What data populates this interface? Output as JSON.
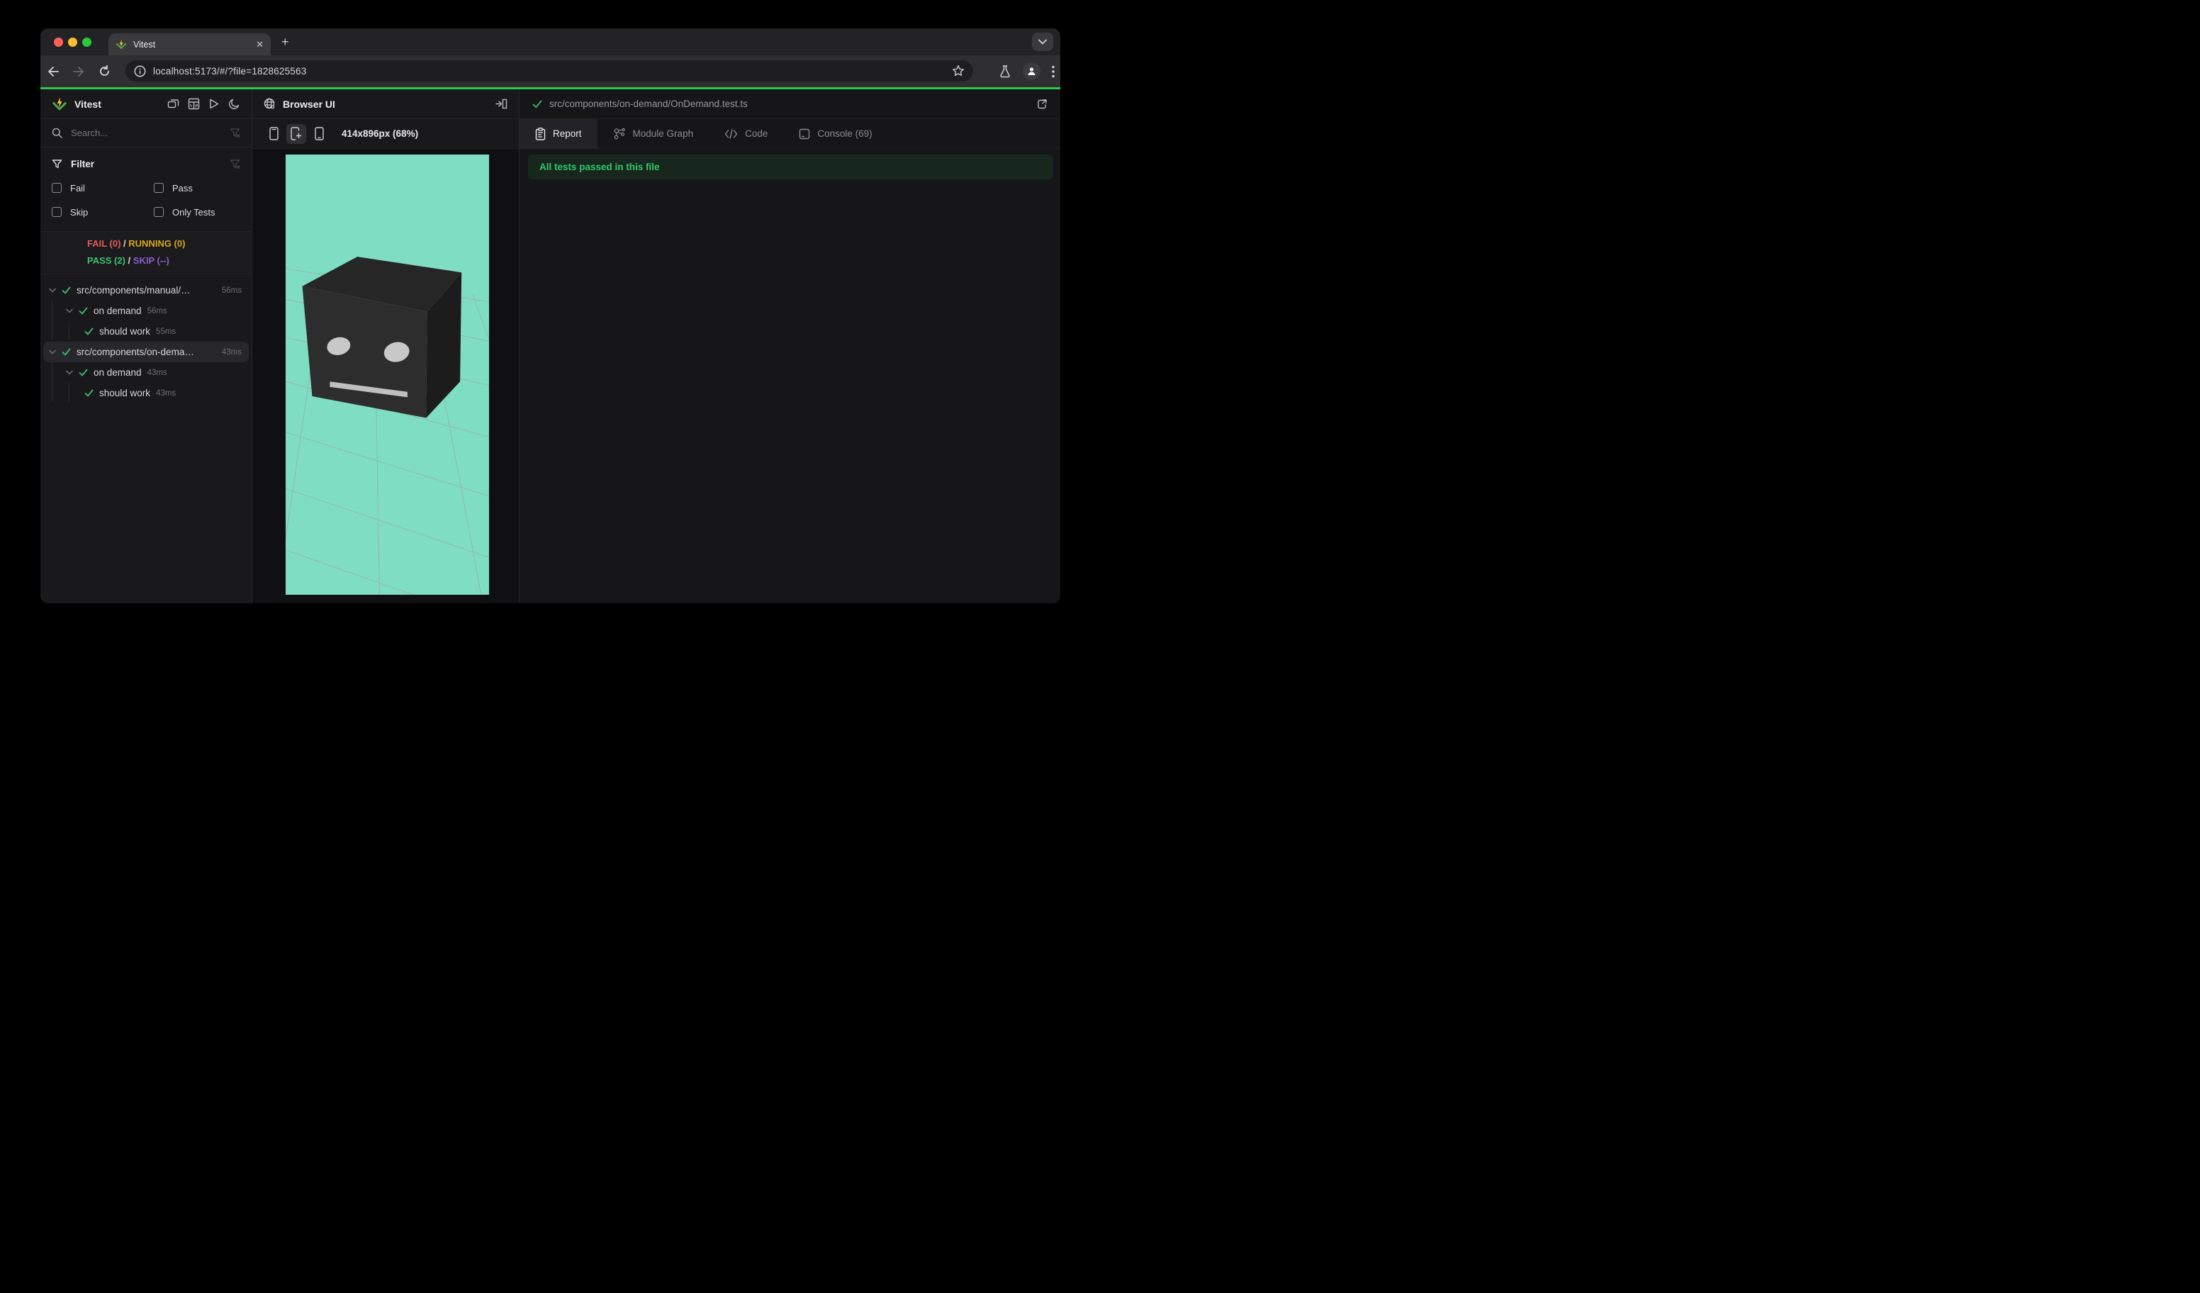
{
  "browser": {
    "tab_title": "Vitest",
    "close_label": "✕",
    "new_tab_label": "+",
    "url": "localhost:5173/#/?file=1828625563"
  },
  "sidebar": {
    "title": "Vitest",
    "search": {
      "placeholder": "Search..."
    },
    "filter": {
      "title": "Filter",
      "options": [
        {
          "label": "Fail"
        },
        {
          "label": "Pass"
        },
        {
          "label": "Skip"
        },
        {
          "label": "Only Tests"
        }
      ]
    },
    "summary": {
      "fail": "FAIL (0)",
      "sep1": " / ",
      "running": "RUNNING (0)",
      "pass": "PASS (2)",
      "sep2": " / ",
      "skip": "SKIP (--)"
    },
    "tree": {
      "items": [
        {
          "label": "src/components/manual/…",
          "duration": "56ms"
        },
        {
          "label": "on demand",
          "duration": "56ms"
        },
        {
          "label": "should work",
          "duration": "55ms"
        },
        {
          "label": "src/components/on-dema…",
          "duration": "43ms"
        },
        {
          "label": "on demand",
          "duration": "43ms"
        },
        {
          "label": "should work",
          "duration": "43ms"
        }
      ]
    }
  },
  "middle": {
    "title": "Browser UI",
    "size_label": "414x896px (68%)"
  },
  "right": {
    "file_path": "src/components/on-demand/OnDemand.test.ts",
    "tabs": [
      {
        "label": "Report"
      },
      {
        "label": "Module Graph"
      },
      {
        "label": "Code"
      },
      {
        "label": "Console (69)"
      }
    ],
    "banner": "All tests passed in this file"
  },
  "colors": {
    "progress_green": "#2fc94d",
    "pass_green": "#3cc06e",
    "fail_red": "#e35b56",
    "running_yellow": "#d7a718",
    "skip_purple": "#8a5fd0",
    "banner_bg": "#17271d",
    "banner_text": "#2ec969",
    "preview_teal": "#7eddc3",
    "cube_front": "#2d2d2d",
    "cube_top": "#262626",
    "cube_side": "#1c1c1c"
  }
}
